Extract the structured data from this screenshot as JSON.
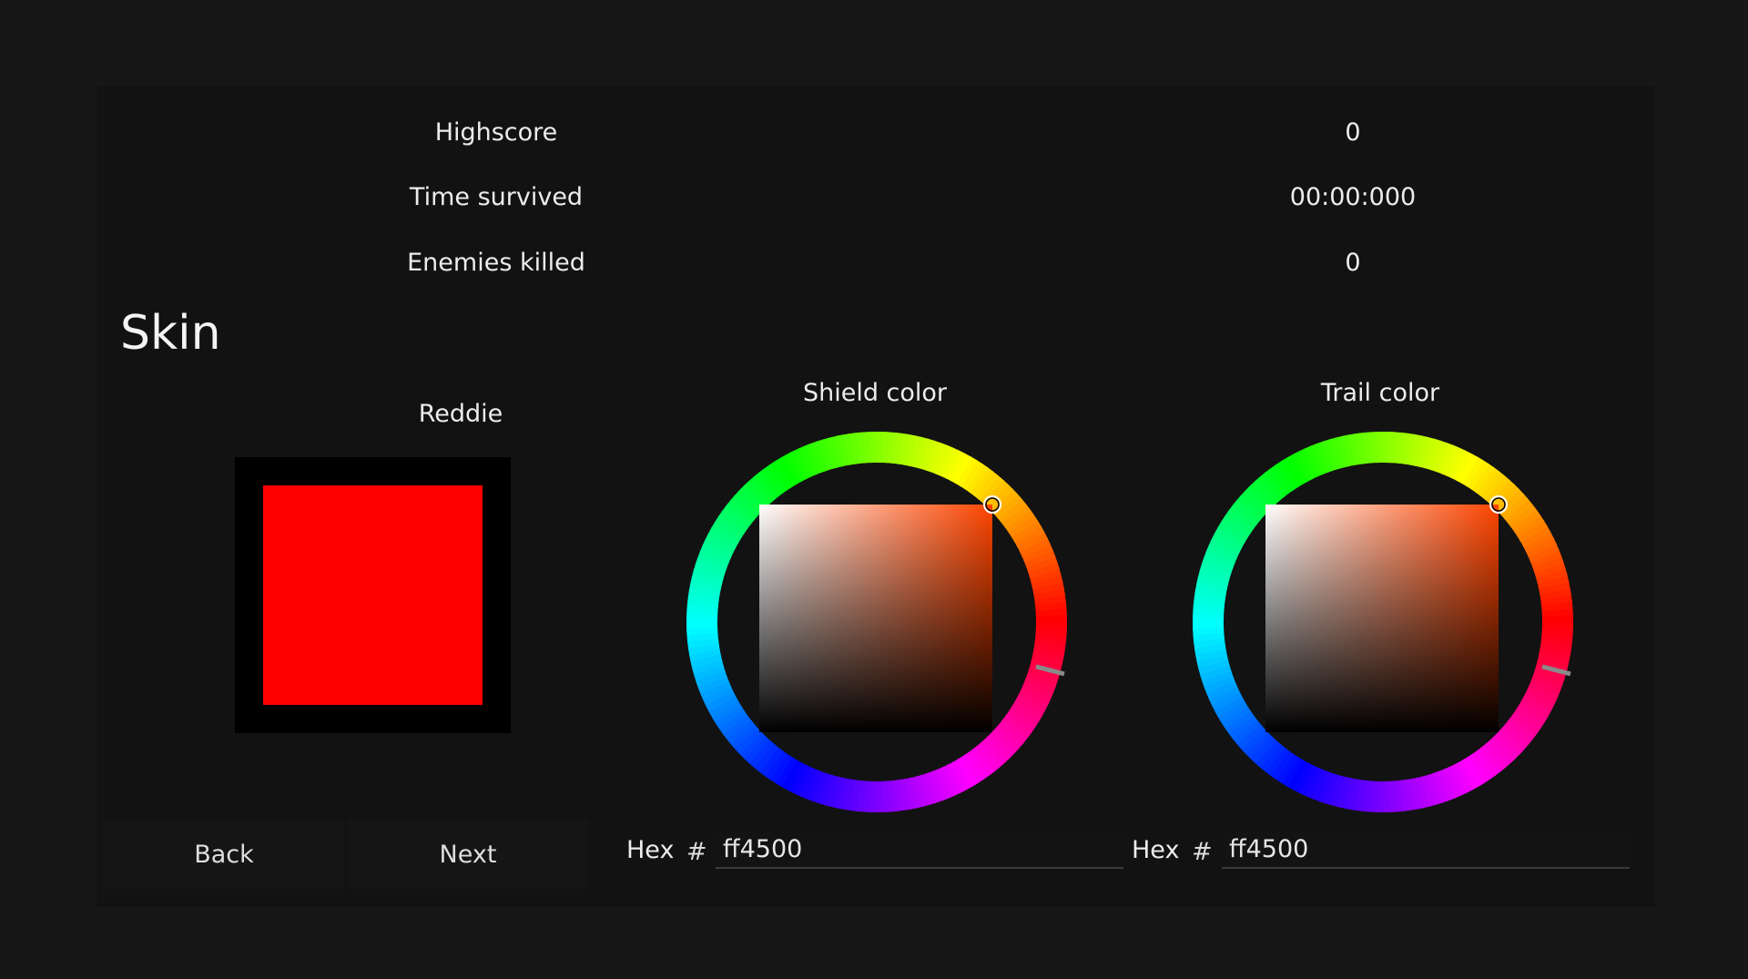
{
  "stats": [
    {
      "label": "Highscore",
      "value": "0"
    },
    {
      "label": "Time survived",
      "value": "00:00:000"
    },
    {
      "label": "Enemies killed",
      "value": "0"
    }
  ],
  "skin": {
    "title": "Skin",
    "name": "Reddie",
    "preview_color": "#ff0000",
    "back_label": "Back",
    "next_label": "Next"
  },
  "shield": {
    "title": "Shield color",
    "hex_label": "Hex",
    "hash": "#",
    "hex_value": "ff4500",
    "color": "#ff4500"
  },
  "trail": {
    "title": "Trail color",
    "hex_label": "Hex",
    "hash": "#",
    "hex_value": "ff4500",
    "color": "#ff4500"
  }
}
